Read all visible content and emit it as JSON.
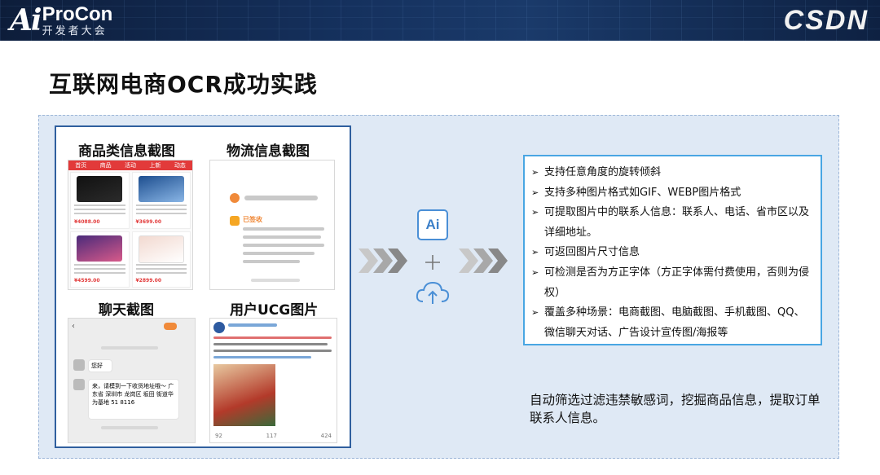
{
  "header": {
    "logo_mark": "Ai",
    "logo_brand": "ProCon",
    "logo_sub": "开发者大会",
    "csdn_logo": "CSDN",
    "colors": {
      "band": "#15315e",
      "text": "#ffffff"
    }
  },
  "title": "互联网电商OCR成功实践",
  "gallery": {
    "product_title": "商品类信息截图",
    "logistics_title": "物流信息截图",
    "chat_title": "聊天截图",
    "ugc_title": "用户UCG图片",
    "product_tabs": [
      "首页",
      "商品",
      "活动",
      "上新",
      "动态"
    ],
    "product_prices": [
      "¥4088.00",
      "¥3699.00",
      "¥4599.00",
      "¥2899.00"
    ],
    "logistics_status": "已签收",
    "chat_greeting": "您好",
    "chat_message": "来，请模到一下收货地址哦～ 广东省 深圳市 龙岗区 坂田 街道华为基地 51 8116",
    "ugc_footer": [
      "92",
      "117",
      "424"
    ]
  },
  "center": {
    "ai_label": "Ai",
    "icons": [
      "chevron-arrows-icon",
      "ai-icon",
      "plus-icon",
      "cloud-upload-icon"
    ],
    "accent": "#4a8fd6"
  },
  "features": {
    "bullet": "➢",
    "items": [
      "支持任意角度的旋转倾斜",
      "支持多种图片格式如GIF、WEBP图片格式",
      "可提取图片中的联系人信息：联系人、电话、省市区以及详细地址。",
      "可返回图片尺寸信息",
      "可检测是否为方正字体（方正字体需付费使用，否则为侵权）",
      "覆盖多种场景：电商截图、电脑截图、手机截图、QQ、微信聊天对话、广告设计宣传图/海报等"
    ]
  },
  "summary": "自动筛选过滤违禁敏感词，挖掘商品信息，提取订单联系人信息。"
}
